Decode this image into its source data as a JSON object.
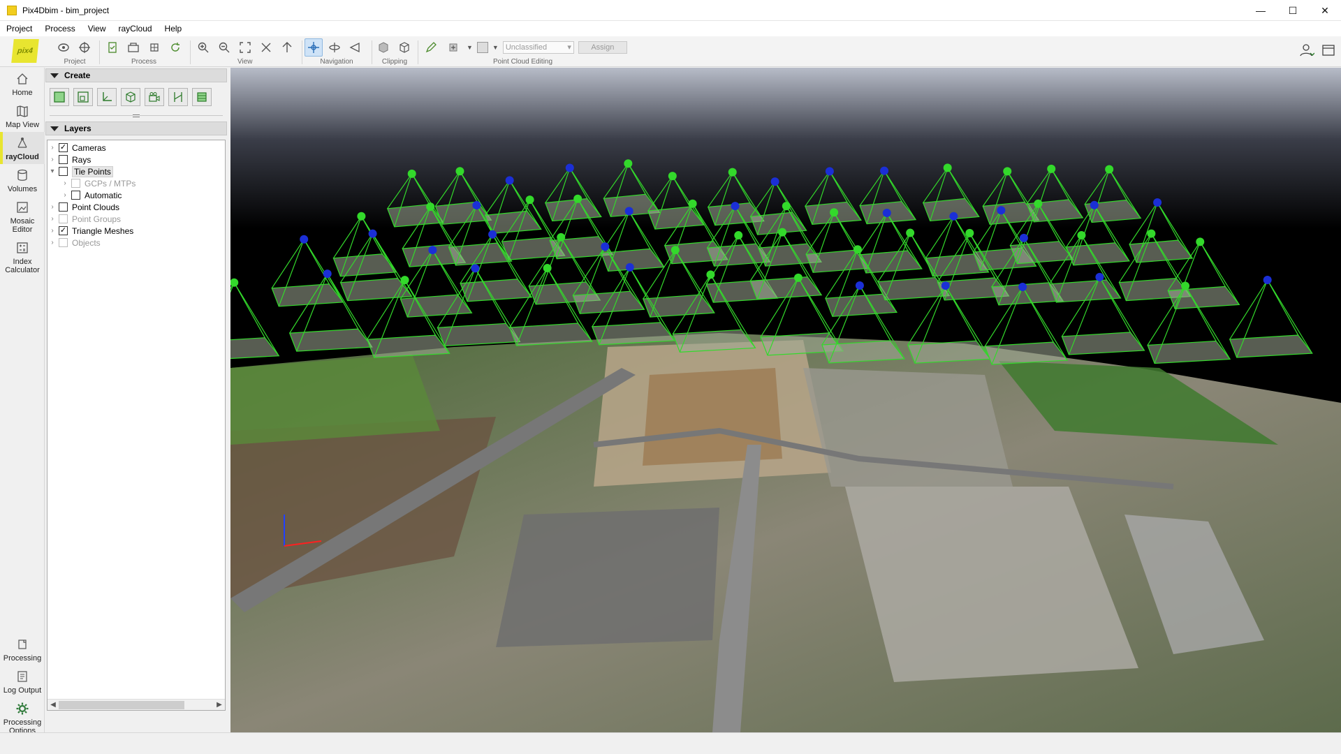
{
  "window": {
    "title": "Pix4Dbim - bim_project",
    "controls": [
      "—",
      "☐",
      "✕"
    ]
  },
  "menu": [
    "Project",
    "Process",
    "View",
    "rayCloud",
    "Help"
  ],
  "toolbar": {
    "logo_text": "pix4",
    "groups": {
      "project": "Project",
      "process": "Process",
      "view": "View",
      "navigation": "Navigation",
      "clipping": "Clipping",
      "point_cloud_editing": "Point Cloud Editing"
    },
    "class_select": "Unclassified",
    "assign_label": "Assign"
  },
  "leftnav": {
    "items": [
      "Home",
      "Map View",
      "rayCloud",
      "Volumes",
      "Mosaic\nEditor",
      "Index\nCalculator"
    ],
    "active": "rayCloud",
    "bottom_items": [
      "Processing",
      "Log Output",
      "Processing\nOptions"
    ]
  },
  "sidepanel": {
    "create_title": "Create",
    "layers_title": "Layers",
    "layers": [
      {
        "label": "Cameras",
        "checked": true,
        "level": 0,
        "disabled": false
      },
      {
        "label": "Rays",
        "checked": false,
        "level": 0,
        "disabled": false
      },
      {
        "label": "Tie Points",
        "checked": false,
        "level": 0,
        "disabled": false,
        "expanded": true,
        "selected": true
      },
      {
        "label": "GCPs / MTPs",
        "checked": false,
        "level": 1,
        "disabled": true
      },
      {
        "label": "Automatic",
        "checked": false,
        "level": 1,
        "disabled": false
      },
      {
        "label": "Point Clouds",
        "checked": false,
        "level": 0,
        "disabled": false
      },
      {
        "label": "Point Groups",
        "checked": false,
        "level": 0,
        "disabled": true
      },
      {
        "label": "Triangle Meshes",
        "checked": true,
        "level": 0,
        "disabled": false
      },
      {
        "label": "Objects",
        "checked": false,
        "level": 0,
        "disabled": true
      }
    ]
  },
  "colors": {
    "accent": "#e8e530",
    "camera_green": "#33d92b",
    "camera_blue": "#1b2fd6"
  }
}
